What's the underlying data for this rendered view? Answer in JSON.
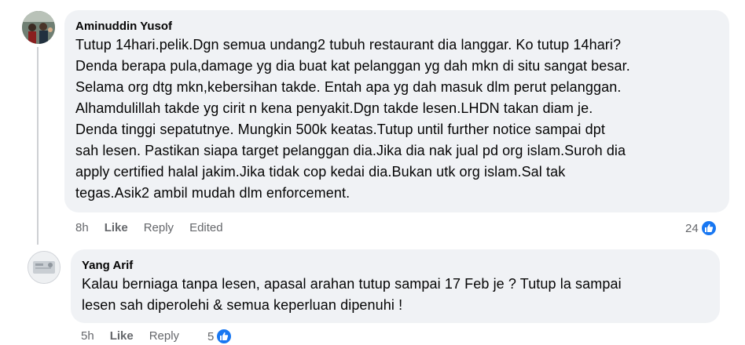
{
  "comments": [
    {
      "author": "Aminuddin Yusof",
      "lines": [
        "Tutup 14hari.pelik.Dgn semua undang2 tubuh restaurant dia langgar. Ko tutup 14hari?",
        "Denda berapa pula,damage yg dia buat kat pelanggan yg dah mkn di situ sangat besar.",
        "Selama org dtg mkn,kebersihan takde. Entah apa yg dah masuk dlm perut pelanggan.",
        "Alhamdulillah takde yg cirit n kena penyakit.Dgn takde lesen.LHDN takan diam je.",
        "Denda tinggi sepatutnye. Mungkin 500k keatas.Tutup until further notice sampai dpt",
        "sah lesen. Pastikan siapa target pelanggan dia.Jika dia nak jual pd org islam.Suroh dia",
        "apply certified halal jakim.Jika tidak cop kedai dia.Bukan utk org islam.Sal tak",
        "tegas.Asik2 ambil mudah dlm enforcement."
      ],
      "time": "8h",
      "like_label": "Like",
      "reply_label": "Reply",
      "edited_label": "Edited",
      "reaction_count": "24",
      "reaction_icon": "like-icon"
    },
    {
      "author": "Yang Arif",
      "lines": [
        "Kalau berniaga tanpa lesen, apasal arahan tutup sampai 17 Feb je ? Tutup la sampai",
        "lesen sah diperolehi & semua keperluan dipenuhi !"
      ],
      "time": "5h",
      "like_label": "Like",
      "reply_label": "Reply",
      "reaction_count": "5",
      "reaction_icon": "like-icon"
    }
  ],
  "colors": {
    "bubble": "#f0f2f5",
    "meta_text": "#65676b",
    "like_blue": "#1877f2"
  }
}
